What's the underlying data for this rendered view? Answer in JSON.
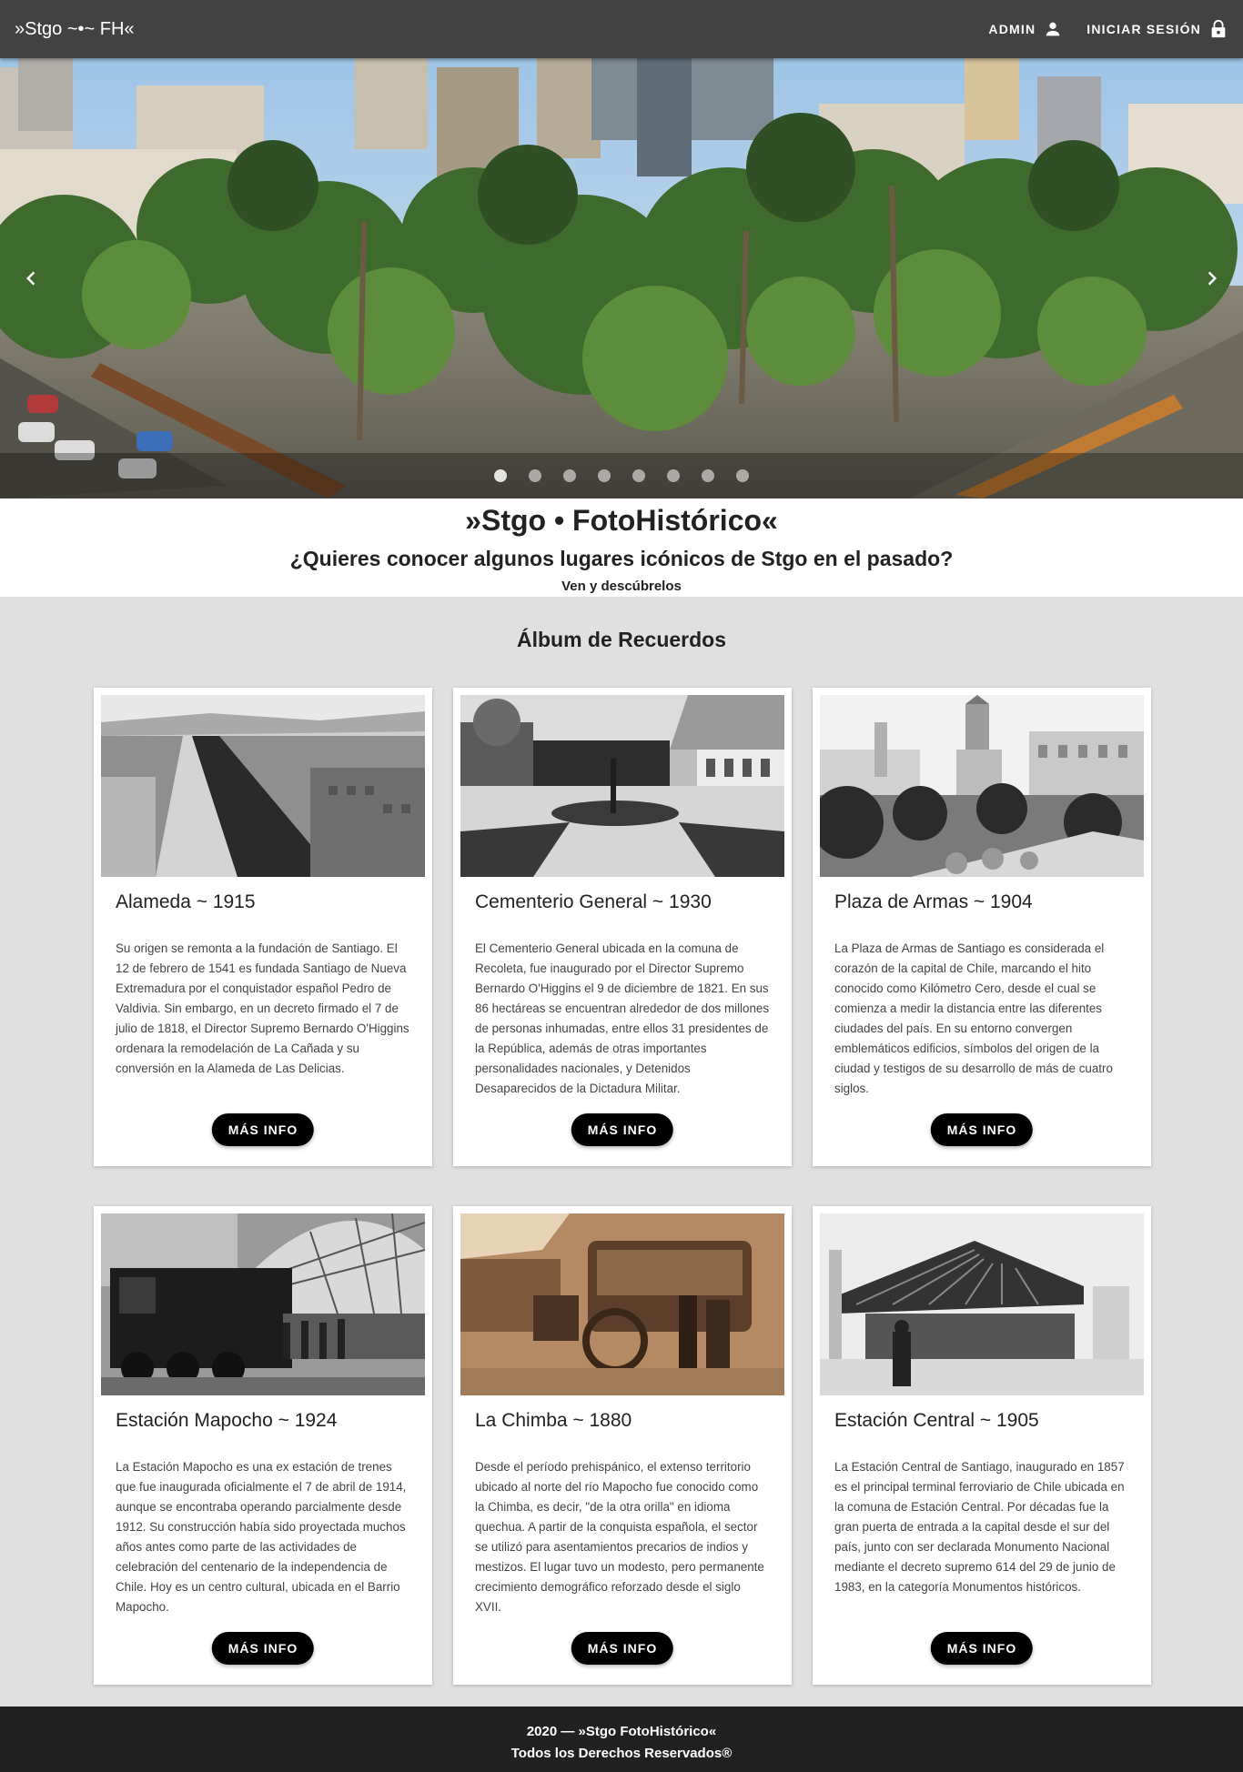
{
  "header": {
    "brand": "»Stgo ~•~ FH«",
    "admin_label": "ADMIN",
    "login_label": "INICIAR SESIÓN"
  },
  "carousel": {
    "slide_count": 8,
    "active_index": 0
  },
  "intro": {
    "title": "»Stgo • FotoHistórico«",
    "subtitle": "¿Quieres conocer algunos lugares icónicos de Stgo en el pasado?",
    "tagline": "Ven y descúbrelos"
  },
  "album": {
    "title": "Álbum de Recuerdos",
    "button_label": "MÁS INFO",
    "cards": [
      {
        "title": "Alameda ~ 1915",
        "text": "Su origen se remonta a la fundación de Santiago. El 12 de febrero de 1541 es fundada Santiago de Nueva Extremadura por el conquistador español Pedro de Valdivia. Sin embargo, en un decreto firmado el 7 de julio de 1818, el Director Supremo Bernardo O'Higgins ordenara la remodelación de La Cañada y su conversión en la Alameda de Las Delicias."
      },
      {
        "title": "Cementerio General ~ 1930",
        "text": "El Cementerio General ubicada en la comuna de Recoleta, fue inaugurado por el Director Supremo Bernardo O'Higgins el 9 de diciembre de 1821. En sus 86 hectáreas se encuentran alrededor de dos millones de personas inhumadas, entre ellos 31 presidentes de la República, además de otras importantes personalidades nacionales, y Detenidos Desaparecidos de la Dictadura Militar."
      },
      {
        "title": "Plaza de Armas ~ 1904",
        "text": "La Plaza de Armas de Santiago es considerada el corazón de la capital de Chile, marcando el hito conocido como Kilómetro Cero, desde el cual se comienza a medir la distancia entre las diferentes ciudades del país. En su entorno convergen emblemáticos edificios, símbolos del origen de la ciudad y testigos de su desarrollo de más de cuatro siglos."
      },
      {
        "title": "Estación Mapocho ~ 1924",
        "text": "La Estación Mapocho es una ex estación de trenes que fue inaugurada oficialmente el 7 de abril de 1914, aunque se encontraba operando parcialmente desde 1912. Su construcción había sido proyectada muchos años antes como parte de las actividades de celebración del centenario de la independencia de Chile. Hoy es un centro cultural, ubicada en el Barrio Mapocho."
      },
      {
        "title": "La Chimba ~ 1880",
        "text": "Desde el período prehispánico, el extenso territorio ubicado al norte del río Mapocho fue conocido como la Chimba, es decir, \"de la otra orilla\" en idioma quechua. A partir de la conquista española, el sector se utilizó para asentamientos precarios de indios y mestizos. El lugar tuvo un modesto, pero permanente crecimiento demográfico reforzado desde el siglo XVII."
      },
      {
        "title": "Estación Central ~ 1905",
        "text": "La Estación Central de Santiago, inaugurado en 1857 es el principal terminal ferroviario de Chile ubicada en la comuna de Estación Central. Por décadas fue la gran puerta de entrada a la capital desde el sur del país, junto con ser declarada Monumento Nacional mediante el decreto supremo 614 del 29 de junio de 1983, en la categoría Monumentos históricos."
      }
    ]
  },
  "footer": {
    "line1": "2020 — »Stgo FotoHistórico«",
    "line2": "Todos los Derechos Reservados®"
  }
}
